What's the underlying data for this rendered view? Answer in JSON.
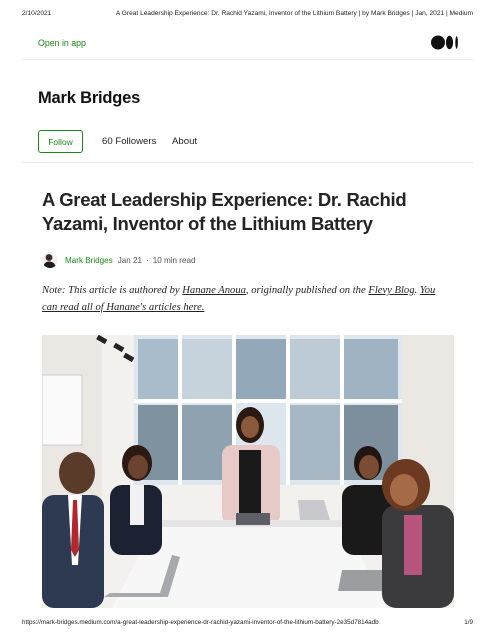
{
  "print_header": {
    "date": "2/10/2021",
    "title": "A Great Leadership Experience: Dr. Rachid Yazami, Inventor of the Lithium Battery | by Mark Bridges | Jan, 2021 | Medium"
  },
  "app_bar": {
    "open_in_app": "Open in app",
    "logo_icon": "medium-logo-icon",
    "accent_color": "#1a8917"
  },
  "profile": {
    "name": "Mark Bridges",
    "follow_label": "Follow",
    "followers_label": "60 Followers",
    "about_label": "About"
  },
  "article": {
    "title": "A Great Leadership Experience: Dr. Rachid Yazami, Inventor of the Lithium Battery",
    "byline": {
      "author": "Mark Bridges",
      "date": "Jan 21",
      "separator": "·",
      "read_time": "10 min read"
    },
    "note": {
      "prefix": "Note: This article is authored by ",
      "author_link": "Hanane Anoua",
      "middle": ", originally published on the ",
      "blog_link": "Flevy Blog",
      "period": ". ",
      "articles_link": "You can read all of Hanane's articles here."
    },
    "photo_icon": "team-meeting-photo"
  },
  "print_footer": {
    "url": "https://mark-bridges.medium.com/a-great-leadership-experience-dr-rachid-yazami-inventor-of-the-lithium-battery-2e35d7814adb",
    "page": "1/9"
  }
}
